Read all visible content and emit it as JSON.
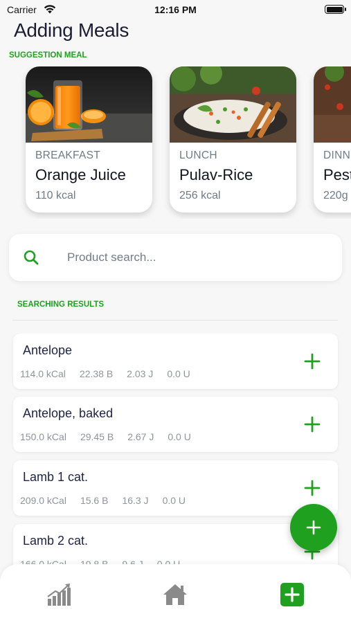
{
  "status_bar": {
    "carrier": "Carrier",
    "time": "12:16 PM"
  },
  "title": "Adding Meals",
  "suggestions": {
    "label": "SUGGESTION MEAL",
    "cards": [
      {
        "type": "BREAKFAST",
        "name": "Orange Juice",
        "kcal": "110 kcal",
        "image": "orange-juice-photo"
      },
      {
        "type": "LUNCH",
        "name": "Pulav-Rice",
        "kcal": "256 kcal",
        "image": "rice-dish-photo"
      },
      {
        "type": "DINNER",
        "name": "Pesto",
        "kcal": "220g",
        "image": "dinner-photo"
      }
    ]
  },
  "search": {
    "placeholder": "Product search...",
    "value": ""
  },
  "results": {
    "label": "SEARCHING RESULTS",
    "items": [
      {
        "name": "Antelope",
        "kcal": "114.0 kCal",
        "b": "22.38 B",
        "j": "2.03 J",
        "u": "0.0 U"
      },
      {
        "name": "Antelope, baked",
        "kcal": "150.0 kCal",
        "b": "29.45 B",
        "j": "2.67 J",
        "u": "0.0 U"
      },
      {
        "name": "Lamb 1 cat.",
        "kcal": "209.0 kCal",
        "b": "15.6 B",
        "j": "16.3 J",
        "u": "0.0 U"
      },
      {
        "name": "Lamb 2 cat.",
        "kcal": "166.0 kCal",
        "b": "19.8 B",
        "j": "9.6 J",
        "u": "0.0 U"
      }
    ]
  },
  "nav": {
    "items": [
      "chart-icon",
      "home-icon",
      "add-square-icon"
    ],
    "active": "add-square-icon"
  },
  "colors": {
    "accent": "#1fa11f",
    "text_dark": "#1d2246",
    "text_muted": "#8f949b"
  }
}
